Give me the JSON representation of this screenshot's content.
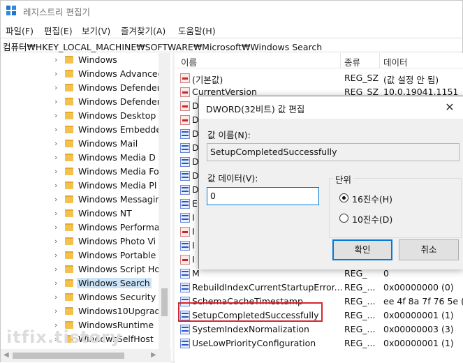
{
  "window": {
    "title": "레지스트리 편집기"
  },
  "menu": [
    "파일(F)",
    "편집(E)",
    "보기(V)",
    "즐겨찾기(A)",
    "도움말(H)"
  ],
  "address": "컴퓨터₩HKEY_LOCAL_MACHINE₩SOFTWARE₩Microsoft₩Windows Search",
  "tree": {
    "items": [
      "Windows",
      "Windows Advanced",
      "Windows Defender",
      "Windows Defender",
      "Windows Desktop",
      "Windows Embedded",
      "Windows Mail",
      "Windows Media D",
      "Windows Media Fo",
      "Windows Media Pl",
      "Windows Messagin",
      "Windows NT",
      "Windows Performa",
      "Windows Photo Vi",
      "Windows Portable",
      "Windows Script Ho",
      "Windows Search",
      "Windows Security",
      "Windows10Upgrad",
      "WindowsRuntime",
      "WindowsSelfHost"
    ],
    "selected_index": 16
  },
  "list": {
    "headers": [
      "이름",
      "종류",
      "데이터"
    ],
    "rows": [
      {
        "icon": "string-value-icon",
        "name": "(기본값)",
        "type": "REG_SZ",
        "data": "(값 설정 안 됨)"
      },
      {
        "icon": "string-value-icon",
        "name": "CurrentVersion",
        "type": "REG_SZ",
        "data": "10.0.19041.1151"
      },
      {
        "icon": "string-value-icon",
        "name": "D",
        "type": "",
        "data": ""
      },
      {
        "icon": "string-value-icon",
        "name": "D",
        "type": "",
        "data": ""
      },
      {
        "icon": "binary-value-icon",
        "name": "D",
        "type": "",
        "data": ""
      },
      {
        "icon": "binary-value-icon",
        "name": "D",
        "type": "",
        "data": ""
      },
      {
        "icon": "binary-value-icon",
        "name": "D",
        "type": "",
        "data": ""
      },
      {
        "icon": "binary-value-icon",
        "name": "D",
        "type": "",
        "data": ""
      },
      {
        "icon": "binary-value-icon",
        "name": "D",
        "type": "",
        "data": ""
      },
      {
        "icon": "binary-value-icon",
        "name": "E",
        "type": "",
        "data": ""
      },
      {
        "icon": "binary-value-icon",
        "name": "I",
        "type": "",
        "data": ""
      },
      {
        "icon": "string-value-icon",
        "name": "I",
        "type": "",
        "data": ""
      },
      {
        "icon": "binary-value-icon",
        "name": "I",
        "type": "",
        "data": ""
      },
      {
        "icon": "string-value-icon",
        "name": "I",
        "type": "",
        "data": ""
      },
      {
        "icon": "binary-value-icon",
        "name": "M",
        "type": "REG_",
        "data": "0"
      },
      {
        "icon": "binary-value-icon",
        "name": "RebuildIndexCurrentStartupError...",
        "type": "REG_...",
        "data": "0x00000000 (0)"
      },
      {
        "icon": "binary-value-icon",
        "name": "SchemaCacheTimestamp",
        "type": "REG_...",
        "data": "ee 4f 8a 7f 76 5e ("
      },
      {
        "icon": "binary-value-icon",
        "name": "SetupCompletedSuccessfully",
        "type": "REG_...",
        "data": "0x00000001 (1)"
      },
      {
        "icon": "binary-value-icon",
        "name": "SystemIndexNormalization",
        "type": "REG_...",
        "data": "0x00000003 (3)"
      },
      {
        "icon": "binary-value-icon",
        "name": "UseLowPriorityConfiguration",
        "type": "REG_...",
        "data": "0x00000001 (1)"
      }
    ]
  },
  "dialog": {
    "title": "DWORD(32비트) 값 편집",
    "name_label": "값 이름(N):",
    "name_value": "SetupCompletedSuccessfully",
    "data_label": "값 데이터(V):",
    "data_value": "0",
    "base_group": "단위",
    "hex_label": "16진수(H)",
    "dec_label": "10진수(D)",
    "selected_base": "hex",
    "ok_label": "확인",
    "cancel_label": "취소"
  },
  "watermark": "itfix.tistory",
  "colors": {
    "highlight_border": "#d8262e",
    "selection": "#cce4f7",
    "accent": "#0078d7"
  }
}
